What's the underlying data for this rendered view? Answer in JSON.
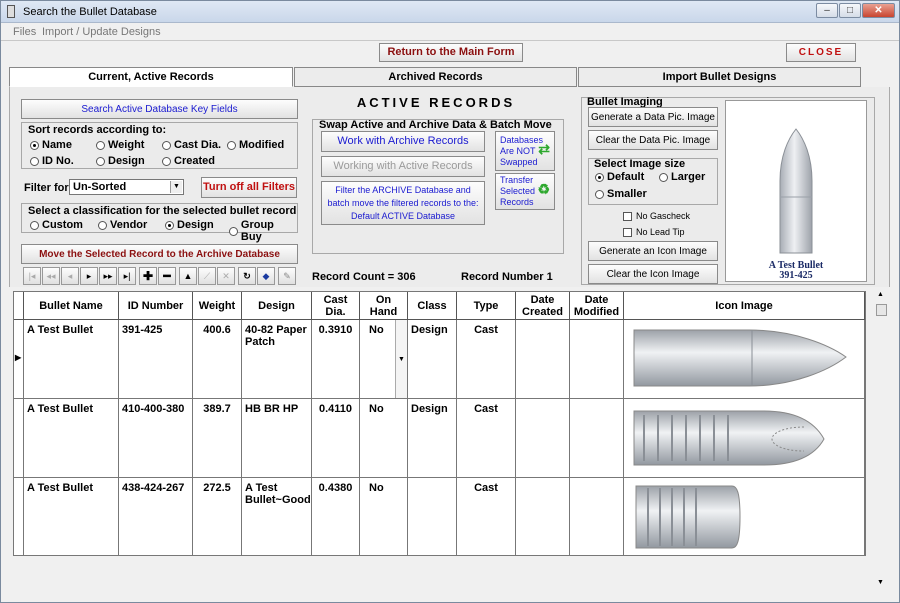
{
  "window": {
    "title": "Search the Bullet Database"
  },
  "menu": [
    "Files",
    "Import / Update Designs"
  ],
  "top": {
    "main_form_button": "Return to the Main Form",
    "close_button": "CLOSE"
  },
  "tabs": [
    "Current, Active Records",
    "Archived Records",
    "Import Bullet Designs"
  ],
  "left": {
    "search_button": "Search Active Database  Key Fields",
    "sort_label": "Sort records according to:",
    "sort_options": [
      "Name",
      "Weight",
      "Cast Dia.",
      "Modified",
      "ID No.",
      "Design",
      "Created"
    ],
    "sort_selected": "Name",
    "filter_label": "Filter for",
    "filter_value": "Un-Sorted",
    "turn_off_filters": "Turn off all Filters",
    "classification_label": "Select a classification for the selected bullet record",
    "classification_options": [
      "Custom",
      "Vendor",
      "Design",
      "Group Buy"
    ],
    "classification_selected": "Design",
    "move_button": "Move the Selected Record to the Archive Database"
  },
  "middle": {
    "heading": "ACTIVE RECORDS",
    "swap_label": "Swap Active and Archive Data & Batch Move",
    "work_archive_button": "Work with Archive Records",
    "working_active_button": "Working with Active Records",
    "databases_line1": "Databases",
    "databases_line2": "Are NOT",
    "databases_line3": "Swapped",
    "filter_archive_text1": "Filter the ARCHIVE Database and",
    "filter_archive_text2": "batch move the filtered records to the:",
    "filter_archive_text3": "Default ACTIVE Database",
    "transfer_line1": "Transfer",
    "transfer_line2": "Selected",
    "transfer_line3": "Records",
    "record_count": "Record Count = 306",
    "record_number": "Record Number  1"
  },
  "imaging": {
    "label": "Bullet Imaging",
    "generate_data_pic": "Generate a Data Pic. Image",
    "clear_data_pic": "Clear the Data Pic. Image",
    "size_label": "Select Image size",
    "size_options": [
      "Default",
      "Larger",
      "Smaller"
    ],
    "size_selected": "Default",
    "no_gascheck": "No Gascheck",
    "no_lead_tip": "No Lead Tip",
    "generate_icon": "Generate an Icon Image",
    "clear_icon": "Clear the Icon Image",
    "preview_name": "A Test Bullet",
    "preview_id": "391-425"
  },
  "grid": {
    "headers": [
      "Bullet Name",
      "ID Number",
      "Weight",
      "Design",
      "Cast Dia.",
      "On Hand",
      "Class",
      "Type",
      "Date Created",
      "Date Modified",
      "Icon Image"
    ],
    "rows": [
      {
        "name": "A Test Bullet",
        "id": "391-425",
        "weight": "400.6",
        "design": "40-82 Paper Patch",
        "dia": "0.3910",
        "onhand": "No",
        "class": "Design",
        "type": "Cast",
        "created": "",
        "modified": ""
      },
      {
        "name": "A Test Bullet",
        "id": "410-400-380",
        "weight": "389.7",
        "design": "HB BR HP",
        "dia": "0.4110",
        "onhand": "No",
        "class": "Design",
        "type": "Cast",
        "created": "",
        "modified": ""
      },
      {
        "name": "A Test Bullet",
        "id": "438-424-267",
        "weight": "272.5",
        "design": "A Test Bullet~GoodS",
        "dia": "0.4380",
        "onhand": "No",
        "class": "",
        "type": "Cast",
        "created": "",
        "modified": ""
      }
    ]
  },
  "colors": {
    "blue_text": "#1a1ad0",
    "red_text": "#c01010",
    "green_arrow": "#2ea82e",
    "preview_text": "#1a2a66"
  }
}
